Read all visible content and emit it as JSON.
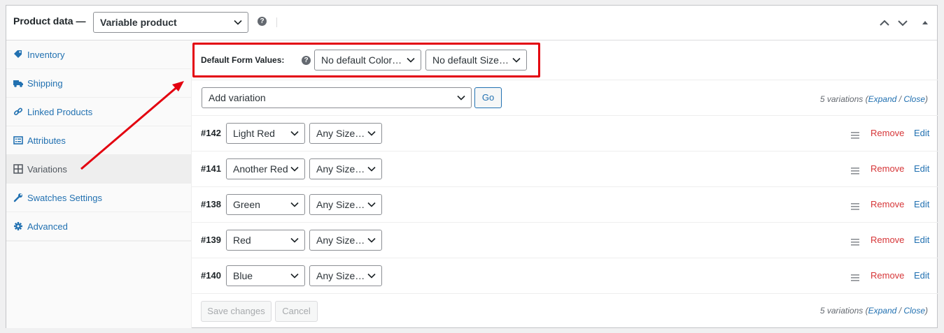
{
  "header": {
    "title": "Product data —",
    "product_type": "Variable product",
    "help": "?"
  },
  "tabs": [
    {
      "label": "Inventory",
      "icon": "tag-icon"
    },
    {
      "label": "Shipping",
      "icon": "truck-icon"
    },
    {
      "label": "Linked Products",
      "icon": "link-icon"
    },
    {
      "label": "Attributes",
      "icon": "list-icon"
    },
    {
      "label": "Variations",
      "icon": "grid-icon",
      "active": true
    },
    {
      "label": "Swatches Settings",
      "icon": "wrench-icon"
    },
    {
      "label": "Advanced",
      "icon": "gear-icon"
    }
  ],
  "defaults": {
    "label": "Default Form Values:",
    "help": "?",
    "color_select": "No default Color…",
    "size_select": "No default Size…"
  },
  "add_variation": {
    "select": "Add variation",
    "go": "Go"
  },
  "summary": {
    "count": "5 variations",
    "open_paren": " (",
    "expand": "Expand",
    "slash": " / ",
    "close": "Close",
    "close_paren": ")"
  },
  "variations": [
    {
      "id": "#142",
      "color": "Light Red",
      "size": "Any Size…"
    },
    {
      "id": "#141",
      "color": "Another Red",
      "size": "Any Size…"
    },
    {
      "id": "#138",
      "color": "Green",
      "size": "Any Size…"
    },
    {
      "id": "#139",
      "color": "Red",
      "size": "Any Size…"
    },
    {
      "id": "#140",
      "color": "Blue",
      "size": "Any Size…"
    }
  ],
  "row_actions": {
    "remove": "Remove",
    "edit": "Edit"
  },
  "footer": {
    "save": "Save changes",
    "cancel": "Cancel"
  },
  "colors": {
    "link": "#2271b1",
    "remove": "#d63638",
    "highlight": "#e3000f"
  }
}
